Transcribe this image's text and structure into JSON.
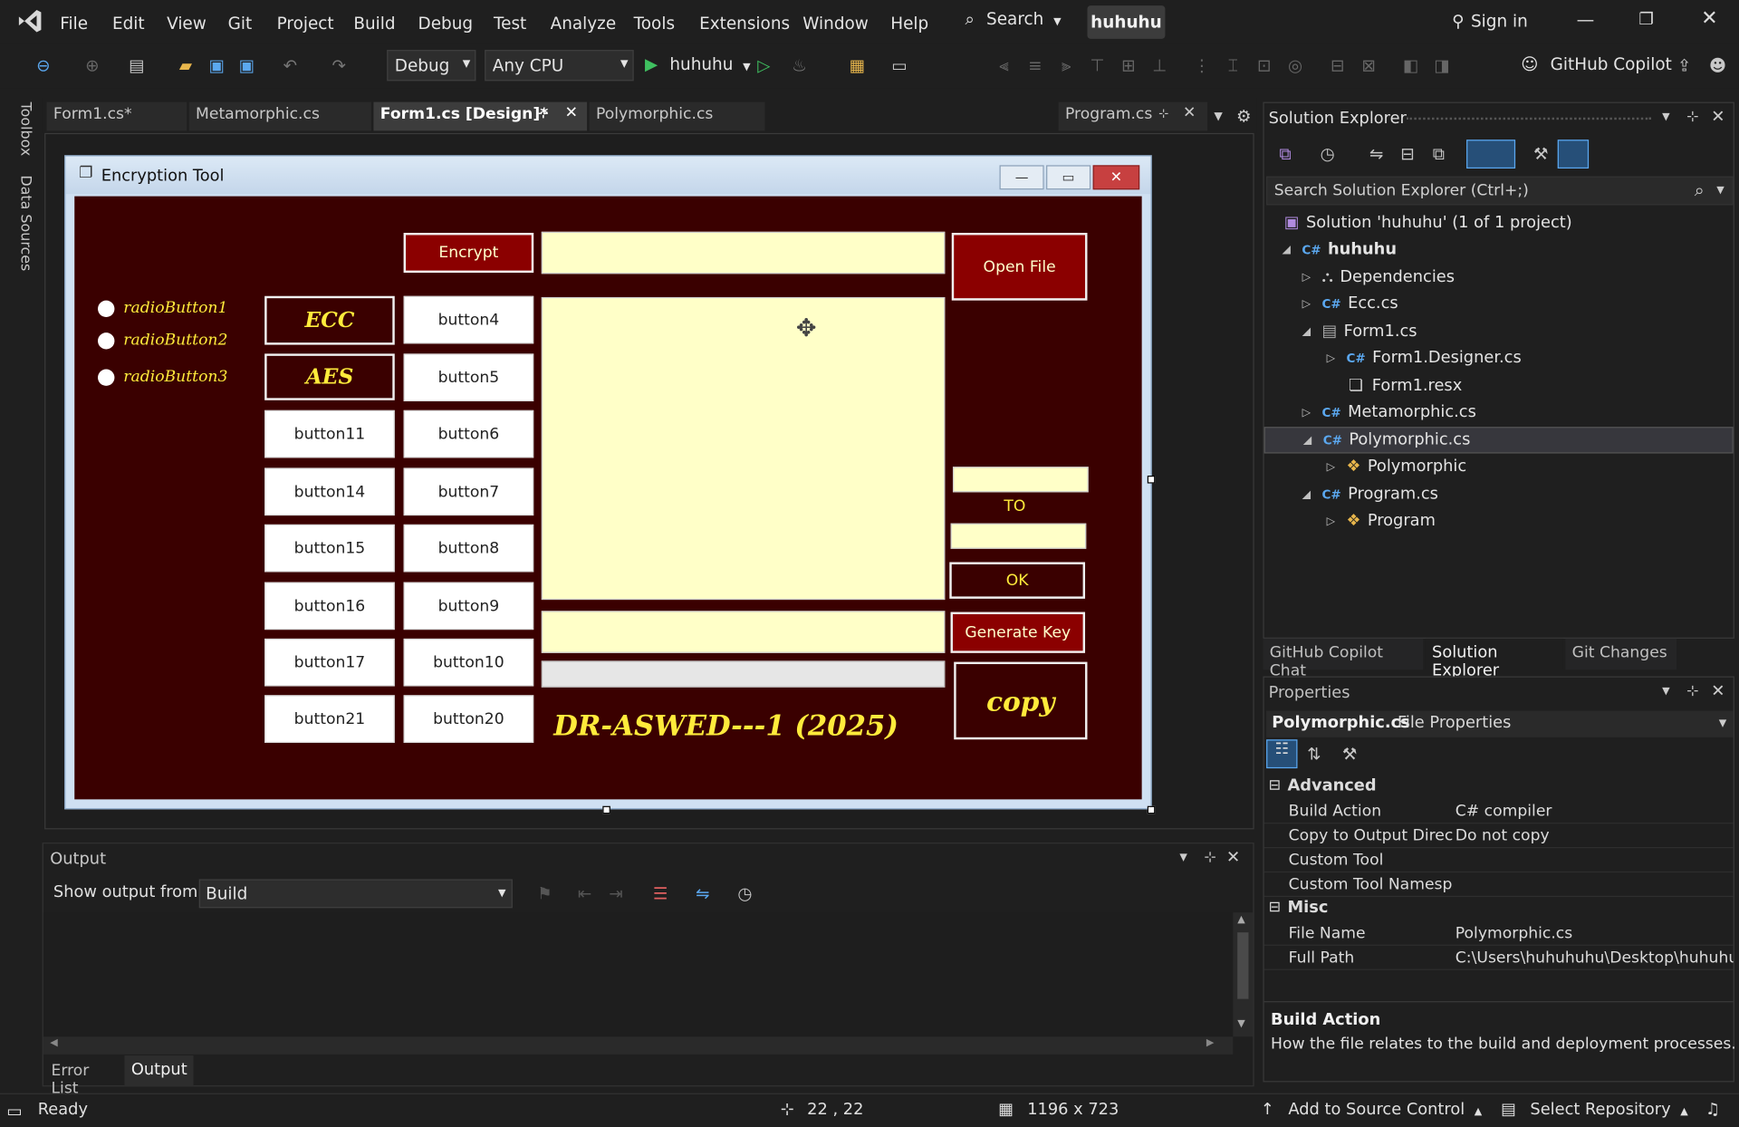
{
  "menu": {
    "items": [
      "File",
      "Edit",
      "View",
      "Git",
      "Project",
      "Build",
      "Debug",
      "Test",
      "Analyze",
      "Tools",
      "Extensions",
      "Window",
      "Help"
    ],
    "search_label": "Search",
    "solution_name": "huhuhu",
    "sign_in": "Sign in"
  },
  "toolbar": {
    "config": "Debug",
    "platform": "Any CPU",
    "run_target": "huhuhu",
    "copilot": "GitHub Copilot"
  },
  "side_tabs": [
    "Toolbox",
    "Data Sources"
  ],
  "editor_tabs": {
    "t1": "Form1.cs*",
    "t2": "Metamorphic.cs",
    "t3": "Form1.cs [Design]*",
    "t4": "Polymorphic.cs",
    "t5": "Program.cs"
  },
  "form": {
    "title": "Encryption Tool",
    "radios": [
      "radioButton1",
      "radioButton2",
      "radioButton3"
    ],
    "encrypt": "Encrypt",
    "open_file": "Open File",
    "ecc": "ECC",
    "aes": "AES",
    "col1": [
      "button11",
      "button14",
      "button15",
      "button16",
      "button17",
      "button21"
    ],
    "col2": [
      "button4",
      "button5",
      "button6",
      "button7",
      "button8",
      "button9",
      "button10",
      "button20"
    ],
    "to": "TO",
    "ok": "OK",
    "generate_key": "Generate Key",
    "copy": "copy",
    "signature": "DR-ASWED---1 (2025)"
  },
  "solution_explorer": {
    "title": "Solution Explorer",
    "search_placeholder": "Search Solution Explorer (Ctrl+;)",
    "solution": "Solution 'huhuhu' (1 of 1 project)",
    "project": "huhuhu",
    "dependencies": "Dependencies",
    "ecc": "Ecc.cs",
    "form1": "Form1.cs",
    "form1_designer": "Form1.Designer.cs",
    "form1_resx": "Form1.resx",
    "metamorphic": "Metamorphic.cs",
    "polymorphic": "Polymorphic.cs",
    "polymorphic_class": "Polymorphic",
    "program": "Program.cs",
    "program_class": "Program",
    "tabs": [
      "GitHub Copilot Chat",
      "Solution Explorer",
      "Git Changes"
    ]
  },
  "properties": {
    "title": "Properties",
    "subject": "Polymorphic.cs",
    "subject_type": "File Properties",
    "cat_advanced": "Advanced",
    "cat_misc": "Misc",
    "rows_advanced": [
      {
        "name": "Build Action",
        "value": "C# compiler"
      },
      {
        "name": "Copy to Output Direct",
        "value": "Do not copy"
      },
      {
        "name": "Custom Tool",
        "value": ""
      },
      {
        "name": "Custom Tool Namespa",
        "value": ""
      }
    ],
    "rows_misc": [
      {
        "name": "File Name",
        "value": "Polymorphic.cs"
      },
      {
        "name": "Full Path",
        "value": "C:\\Users\\huhuhuhu\\Desktop\\huhuhu\\h"
      }
    ],
    "desc_title": "Build Action",
    "desc_text": "How the file relates to the build and deployment processes."
  },
  "output": {
    "title": "Output",
    "show_from": "Show output from:",
    "source": "Build",
    "tabs": [
      "Error List",
      "Output"
    ]
  },
  "status": {
    "ready": "Ready",
    "position": "22 , 22",
    "size": "1196 x 723",
    "source_control": "Add to Source Control",
    "repo": "Select Repository"
  },
  "colors": {
    "form_bg": "#3a0000",
    "accent_yellow": "#ffeb3b",
    "red_button": "#8b0000",
    "ide_bg": "#1f1f1f"
  }
}
